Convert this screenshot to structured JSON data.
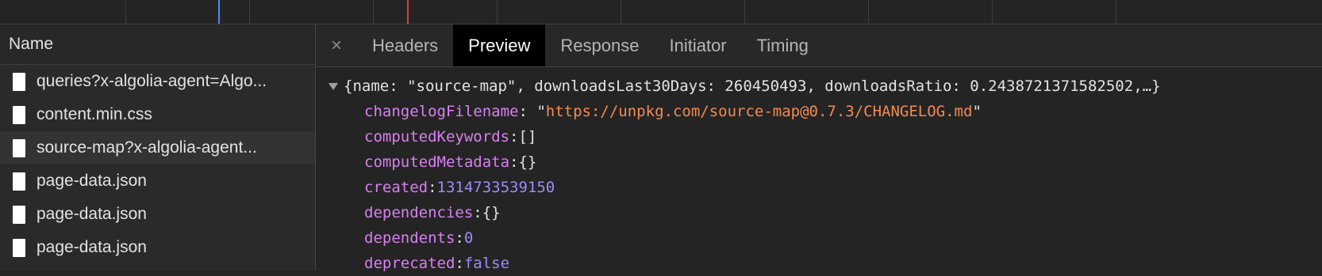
{
  "request_list": {
    "column_header": "Name",
    "items": [
      {
        "name": "queries?x-algolia-agent=Algo..."
      },
      {
        "name": "content.min.css"
      },
      {
        "name": "source-map?x-algolia-agent..."
      },
      {
        "name": "page-data.json"
      },
      {
        "name": "page-data.json"
      },
      {
        "name": "page-data.json"
      }
    ]
  },
  "tabs": {
    "close_glyph": "×",
    "items": [
      {
        "label": "Headers"
      },
      {
        "label": "Preview",
        "active": true
      },
      {
        "label": "Response"
      },
      {
        "label": "Initiator"
      },
      {
        "label": "Timing"
      }
    ]
  },
  "preview": {
    "summary": "{name: \"source-map\", downloadsLast30Days: 260450493, downloadsRatio: 0.2438721371582502,…}",
    "fields": [
      {
        "key": "changelogFilename",
        "value": "https://unpkg.com/source-map@0.7.3/CHANGELOG.md",
        "type": "string"
      },
      {
        "key": "computedKeywords",
        "value": "[]",
        "type": "plain"
      },
      {
        "key": "computedMetadata",
        "value": "{}",
        "type": "plain"
      },
      {
        "key": "created",
        "value": "1314733539150",
        "type": "number"
      },
      {
        "key": "dependencies",
        "value": "{}",
        "type": "plain"
      },
      {
        "key": "dependents",
        "value": "0",
        "type": "number"
      },
      {
        "key": "deprecated",
        "value": "false",
        "type": "keyword"
      }
    ]
  },
  "colors": {
    "background": "#242424",
    "key": "#d880f0",
    "string": "#f28b54",
    "number": "#9d8cf6",
    "active_tab": "#000000"
  }
}
